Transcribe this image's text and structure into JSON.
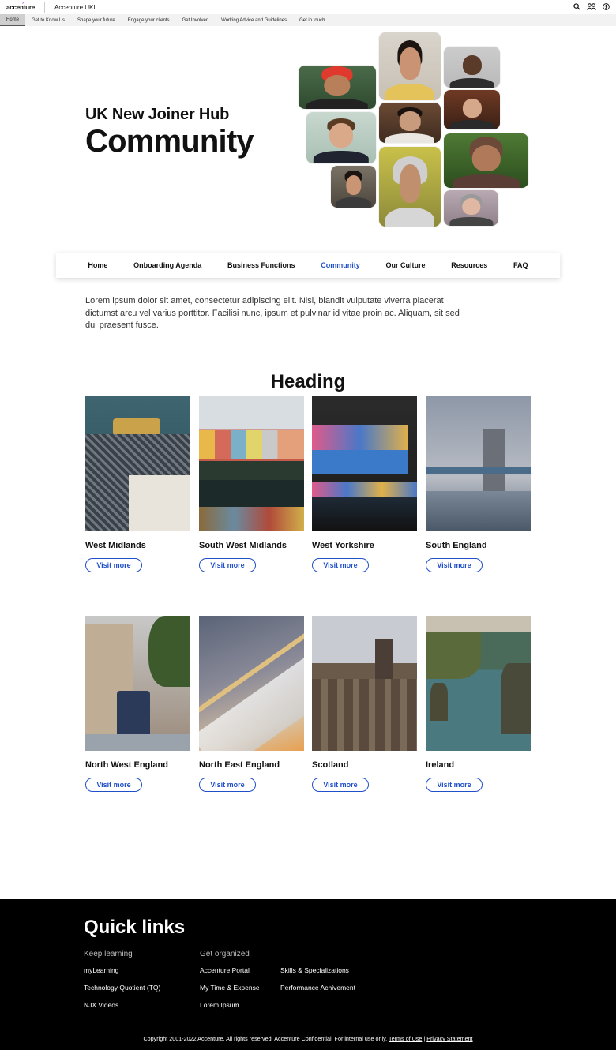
{
  "topbar": {
    "logo": "accenture",
    "site_name": "Accenture UKI",
    "icons": [
      "search-icon",
      "people-icon",
      "accessibility-icon"
    ]
  },
  "subnav": [
    {
      "label": "Home",
      "active": true
    },
    {
      "label": "Get to Know Us"
    },
    {
      "label": "Shape your future"
    },
    {
      "label": "Engage your clients"
    },
    {
      "label": "Get Involved"
    },
    {
      "label": "Working Advice and Guidelines"
    },
    {
      "label": "Get in touch"
    }
  ],
  "hero": {
    "subtitle": "UK New Joiner Hub",
    "title": "Community"
  },
  "mainnav": [
    {
      "label": "Home"
    },
    {
      "label": "Onboarding Agenda"
    },
    {
      "label": "Business Functions"
    },
    {
      "label": "Community",
      "active": true
    },
    {
      "label": "Our Culture"
    },
    {
      "label": "Resources"
    },
    {
      "label": "FAQ"
    }
  ],
  "intro": "Lorem ipsum dolor sit amet, consectetur adipiscing elit. Nisi, blandit vulputate viverra placerat dictumst arcu vel varius porttitor. Facilisi nunc, ipsum et pulvinar id vitae proin ac. Aliquam, sit sed dui praesent fusce.",
  "section_heading": "Heading",
  "cards": [
    {
      "title": "West Midlands",
      "button": "Visit more"
    },
    {
      "title": "South West Midlands",
      "button": "Visit more"
    },
    {
      "title": "West Yorkshire",
      "button": "Visit more"
    },
    {
      "title": "South England",
      "button": "Visit more"
    },
    {
      "title": "North West England",
      "button": "Visit more"
    },
    {
      "title": "North East England",
      "button": "Visit more"
    },
    {
      "title": "Scotland",
      "button": "Visit more"
    },
    {
      "title": "Ireland",
      "button": "Visit more"
    }
  ],
  "footer": {
    "title": "Quick links",
    "col1": {
      "heading": "Keep learning",
      "links": [
        "myLearning",
        "Technology Quotient (TQ)",
        "NJX Videos"
      ]
    },
    "col2": {
      "heading": "Get organized",
      "links": [
        "Accenture Portal",
        "My Time & Expense",
        "Lorem Ipsum"
      ]
    },
    "col3": {
      "links": [
        "Skills & Specializations",
        "Performance Achivement"
      ]
    },
    "copyright": "Copyright 2001-2022 Accenture. All rights reserved. Accenture Confidential. For internal use only.",
    "terms": "Terms of Use",
    "separator": "|",
    "privacy": "Privacy Statement"
  },
  "colors": {
    "accent_blue": "#1f4fc9",
    "brand_purple": "#a100ff",
    "footer_bg": "#000000"
  }
}
